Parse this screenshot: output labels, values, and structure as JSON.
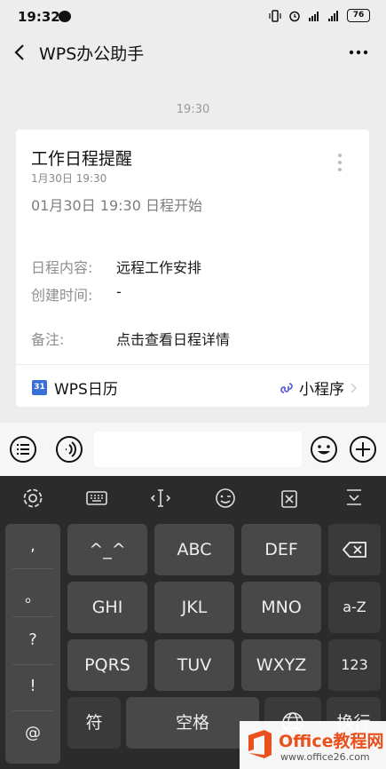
{
  "status_bar": {
    "time": "19:32",
    "battery": "76"
  },
  "nav": {
    "title": "WPS办公助手"
  },
  "chat": {
    "timestamp": "19:30"
  },
  "card": {
    "title": "工作日程提醒",
    "date": "1月30日  19:30",
    "subtitle": "01月30日 19:30 日程开始",
    "rows": [
      {
        "label": "日程内容:",
        "value": "远程工作安排"
      },
      {
        "label": "创建时间:",
        "value": "-"
      },
      {
        "label": "备注:",
        "value": "点击查看日程详情"
      }
    ],
    "footer_left": "WPS日历",
    "footer_left_icon": "31",
    "footer_right": "小程序"
  },
  "keyboard": {
    "punct": [
      ",",
      "。",
      "?",
      "!",
      "@"
    ],
    "row1": [
      "^_^",
      "ABC",
      "DEF"
    ],
    "row2": [
      "GHI",
      "JKL",
      "MNO",
      "a-Z"
    ],
    "row3": [
      "PQRS",
      "TUV",
      "WXYZ",
      "123"
    ],
    "row4": {
      "sym": "符",
      "space": "空格",
      "enter": "换行"
    }
  },
  "watermark": {
    "brand": "Office教程网",
    "url": "www.office26.com"
  },
  "colors": {
    "accent_blue": "#3b6fd8",
    "link_purple": "#5b63d6",
    "watermark_orange": "#e8511d"
  }
}
